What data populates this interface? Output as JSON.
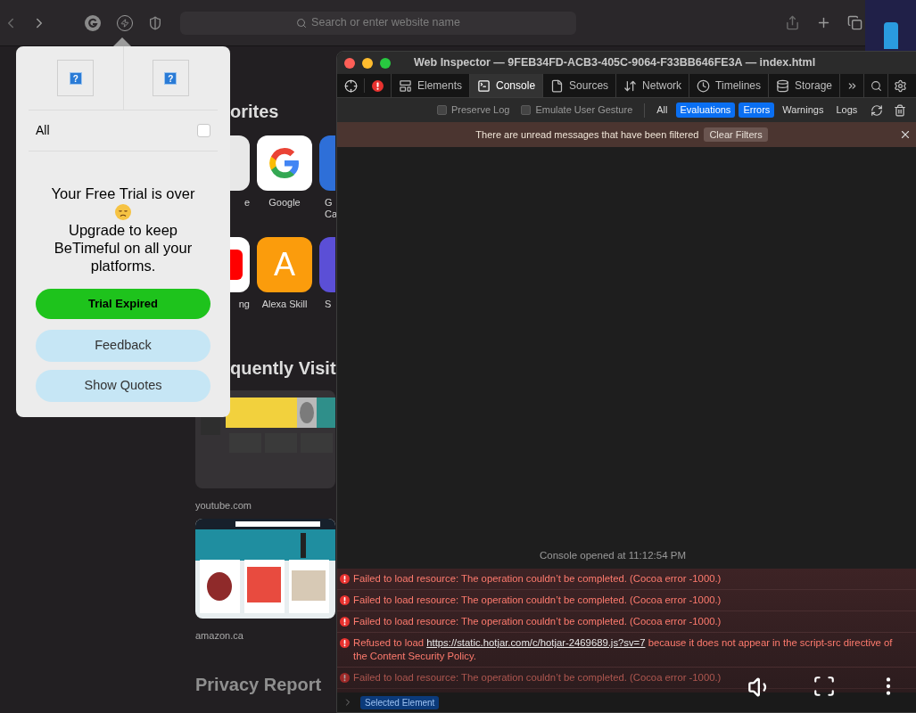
{
  "browser": {
    "search": {
      "placeholder": "Search or enter website name"
    }
  },
  "start_page": {
    "favorites_heading": "orites",
    "favorite_rows": [
      [
        {
          "kind": "grey",
          "label": "e"
        },
        {
          "kind": "google",
          "label": "Google"
        },
        {
          "kind": "blue",
          "label": "G Ca"
        }
      ],
      [
        {
          "kind": "red",
          "label": "ng"
        },
        {
          "kind": "letter",
          "letter": "A",
          "label": "Alexa Skill"
        },
        {
          "kind": "purple",
          "label": "S"
        }
      ]
    ],
    "frequent_heading": "quently Visit",
    "frequent": [
      {
        "kind": "video-site",
        "label": "youtube.com"
      },
      {
        "kind": "shop-site",
        "label": "amazon.ca"
      }
    ],
    "privacy_heading": "Privacy Report"
  },
  "popup": {
    "images": [
      "?",
      "?"
    ],
    "filter": {
      "label": "All",
      "checked": false
    },
    "message_top": "Your Free Trial is over",
    "message_bottom": "Upgrade to keep BeTimeful on all your platforms.",
    "buttons": [
      {
        "kind": "primary",
        "label": "Trial Expired"
      },
      {
        "kind": "secondary",
        "label": "Feedback"
      },
      {
        "kind": "secondary",
        "label": "Show Quotes"
      }
    ]
  },
  "inspector": {
    "title": "Web Inspector — 9FEB34FD-ACB3-405C-9064-F33BB646FE3A — index.html",
    "tabs": [
      {
        "label": "Elements",
        "selected": false
      },
      {
        "label": "Console",
        "selected": true
      },
      {
        "label": "Sources",
        "selected": false
      },
      {
        "label": "Network",
        "selected": false
      },
      {
        "label": "Timelines",
        "selected": false
      },
      {
        "label": "Storage",
        "selected": false
      }
    ],
    "options": [
      {
        "label": "Preserve Log",
        "checked": false
      },
      {
        "label": "Emulate User Gesture",
        "checked": false
      }
    ],
    "filters": [
      {
        "label": "All",
        "selected": false
      },
      {
        "label": "Evaluations",
        "selected": true
      },
      {
        "label": "Errors",
        "selected": true
      },
      {
        "label": "Warnings",
        "selected": false
      },
      {
        "label": "Logs",
        "selected": false
      }
    ],
    "banner": {
      "text": "There are unread messages that have been filtered",
      "button": "Clear Filters"
    },
    "opened": "Console opened at 11:12:54 PM",
    "messages": [
      {
        "kind": "error",
        "text": "Failed to load resource: The operation couldn’t be completed. (Cocoa error -1000.)"
      },
      {
        "kind": "error",
        "text": "Failed to load resource: The operation couldn’t be completed. (Cocoa error -1000.)"
      },
      {
        "kind": "error",
        "text": "Failed to load resource: The operation couldn’t be completed. (Cocoa error -1000.)"
      },
      {
        "kind": "error",
        "text": "Refused to load",
        "link": "https://static.hotjar.com/c/hotjar-2469689.js?sv=7",
        "after": "because it does not appear in the script-src directive of the Content Security Policy."
      },
      {
        "kind": "error",
        "text": "Failed to load resource: The operation couldn’t be completed. (Cocoa error -1000.)"
      }
    ],
    "prompt": "Selected Element"
  }
}
